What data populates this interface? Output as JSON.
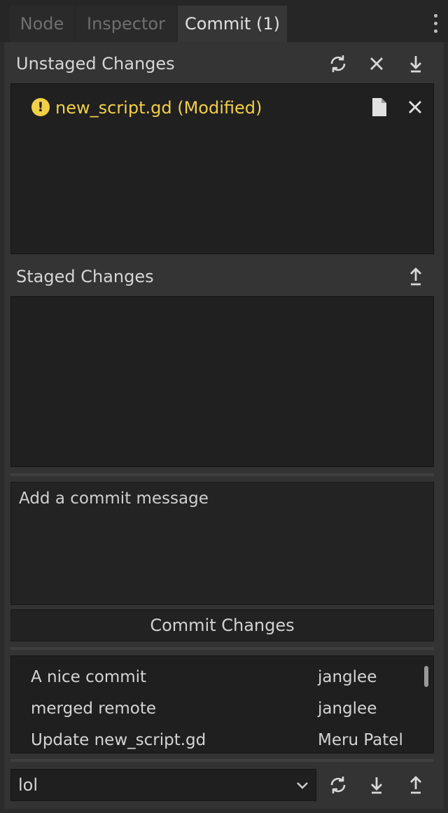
{
  "tabs": [
    {
      "label": "Node"
    },
    {
      "label": "Inspector"
    },
    {
      "label": "Commit (1)"
    }
  ],
  "unstaged": {
    "title": "Unstaged Changes",
    "files": [
      {
        "label": "new_script.gd (Modified)",
        "status_color": "#f2cf48"
      }
    ]
  },
  "staged": {
    "title": "Staged Changes"
  },
  "commit": {
    "message_placeholder": "Add a commit message",
    "button_label": "Commit Changes"
  },
  "history": [
    {
      "message": "A nice commit",
      "author": "janglee"
    },
    {
      "message": "merged remote",
      "author": "janglee"
    },
    {
      "message": "Update new_script.gd",
      "author": "Meru Patel"
    }
  ],
  "branch": {
    "selected": "lol"
  },
  "icons": {
    "menu": "kebab-menu-icon",
    "refresh": "refresh-icon",
    "discard": "close-icon",
    "stage_all": "arrow-down-icon",
    "unstage_all": "arrow-up-icon",
    "view_file": "file-icon",
    "warning": "warning-icon",
    "dropdown": "chevron-down-icon",
    "pull": "pull-icon",
    "push": "push-icon"
  },
  "colors": {
    "modified": "#f2cf48",
    "background": "#2b2b2b",
    "list_background": "#202020"
  }
}
